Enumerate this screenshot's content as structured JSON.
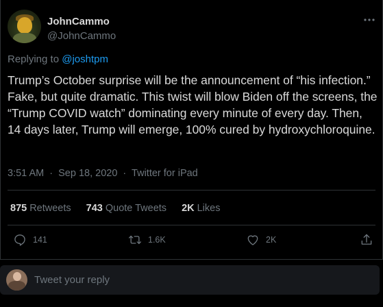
{
  "author": {
    "display_name": "JohnCammo",
    "handle": "@JohnCammo"
  },
  "replying": {
    "prefix": "Replying to",
    "mention": "@joshtpm"
  },
  "tweet": {
    "text": "Trump’s October surprise will be the announcement of “his infection.”  Fake, but quite dramatic. This twist will blow Biden off the screens, the “Trump COVID watch” dominating every minute of every day.  Then, 14 days later, Trump will emerge, 100% cured by hydroxychloroquine.",
    "time": "3:51 AM",
    "date": "Sep 18, 2020",
    "separator": "·",
    "source": "Twitter for iPad"
  },
  "stats": {
    "retweets_count": "875",
    "retweets_label": "Retweets",
    "quotes_count": "743",
    "quotes_label": "Quote Tweets",
    "likes_count": "2K",
    "likes_label": "Likes"
  },
  "actions": {
    "reply_count": "141",
    "retweet_count": "1.6K",
    "like_count": "2K"
  },
  "reply_box": {
    "placeholder": "Tweet your reply"
  },
  "icons": {
    "more": "more-horizontal-icon",
    "reply": "reply-icon",
    "retweet": "retweet-icon",
    "like": "heart-icon",
    "share": "share-icon"
  },
  "colors": {
    "background": "#000000",
    "text": "#d9d9d9",
    "muted": "#6e767d",
    "accent": "#1d9bf0",
    "border": "#2f3336",
    "reply_box": "#16181c"
  }
}
